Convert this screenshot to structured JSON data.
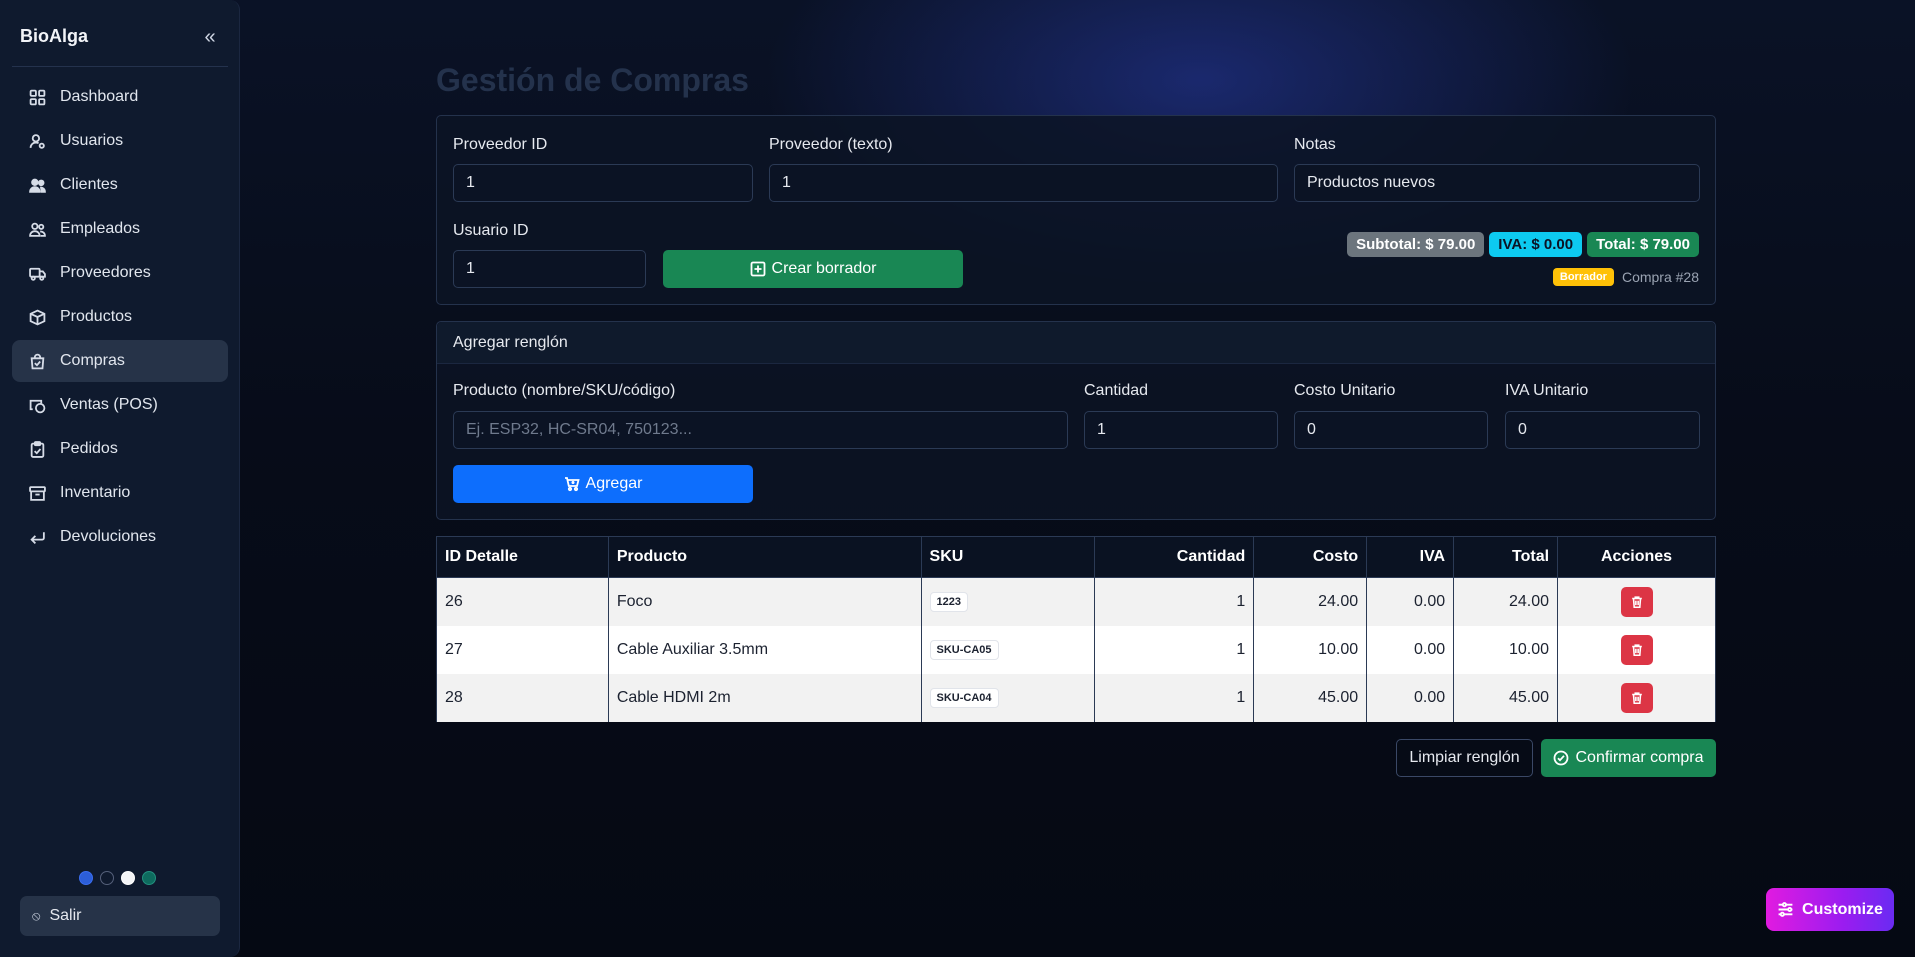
{
  "sidebar": {
    "brand": "BioAlga",
    "collapse_icon": "«",
    "items": [
      {
        "label": "Dashboard",
        "icon": "grid-icon"
      },
      {
        "label": "Usuarios",
        "icon": "user-gear-icon"
      },
      {
        "label": "Clientes",
        "icon": "people-icon"
      },
      {
        "label": "Empleados",
        "icon": "people-outline-icon"
      },
      {
        "label": "Proveedores",
        "icon": "truck-icon"
      },
      {
        "label": "Productos",
        "icon": "box-icon"
      },
      {
        "label": "Compras",
        "icon": "bag-check-icon",
        "active": true
      },
      {
        "label": "Ventas (POS)",
        "icon": "cash-coin-icon"
      },
      {
        "label": "Pedidos",
        "icon": "clipboard-check-icon"
      },
      {
        "label": "Inventario",
        "icon": "archive-icon"
      },
      {
        "label": "Devoluciones",
        "icon": "return-arrow-icon"
      }
    ],
    "theme_colors": [
      "#2c5ed8",
      "#0f1a2e",
      "#f4f5f7",
      "#0e6b5e"
    ],
    "logout_label": "Salir"
  },
  "page": {
    "title": "Gestión de Compras"
  },
  "header_form": {
    "proveedor_id_label": "Proveedor ID",
    "proveedor_id_value": "1",
    "proveedor_texto_label": "Proveedor (texto)",
    "proveedor_texto_value": "1",
    "notas_label": "Notas",
    "notas_value": "Productos nuevos",
    "usuario_id_label": "Usuario ID",
    "usuario_id_value": "1",
    "crear_borrador_label": "Crear borrador",
    "subtotal": "Subtotal: $ 79.00",
    "iva": "IVA: $ 0.00",
    "total": "Total: $ 79.00",
    "status_badge": "Borrador",
    "compra_no": "Compra #28"
  },
  "add_row": {
    "header": "Agregar renglón",
    "producto_label": "Producto (nombre/SKU/código)",
    "producto_placeholder": "Ej. ESP32, HC-SR04, 750123...",
    "cantidad_label": "Cantidad",
    "cantidad_value": "1",
    "costo_label": "Costo Unitario",
    "costo_value": "0",
    "iva_label": "IVA Unitario",
    "iva_value": "0",
    "agregar_label": "Agregar"
  },
  "table": {
    "columns": [
      "ID Detalle",
      "Producto",
      "SKU",
      "Cantidad",
      "Costo",
      "IVA",
      "Total",
      "Acciones"
    ],
    "rows": [
      {
        "id": "26",
        "producto": "Foco",
        "sku": "1223",
        "cantidad": "1",
        "costo": "24.00",
        "iva": "0.00",
        "total": "24.00"
      },
      {
        "id": "27",
        "producto": "Cable Auxiliar 3.5mm",
        "sku": "SKU-CA05",
        "cantidad": "1",
        "costo": "10.00",
        "iva": "0.00",
        "total": "10.00"
      },
      {
        "id": "28",
        "producto": "Cable HDMI 2m",
        "sku": "SKU-CA04",
        "cantidad": "1",
        "costo": "45.00",
        "iva": "0.00",
        "total": "45.00"
      }
    ]
  },
  "footer_actions": {
    "limpiar_label": "Limpiar renglón",
    "confirmar_label": "Confirmar compra"
  },
  "customize_label": "Customize",
  "colors": {
    "accent_green": "#198754",
    "accent_blue": "#0d6efd",
    "danger": "#dc3545",
    "warning": "#ffc107",
    "info": "#0dcaf0"
  }
}
